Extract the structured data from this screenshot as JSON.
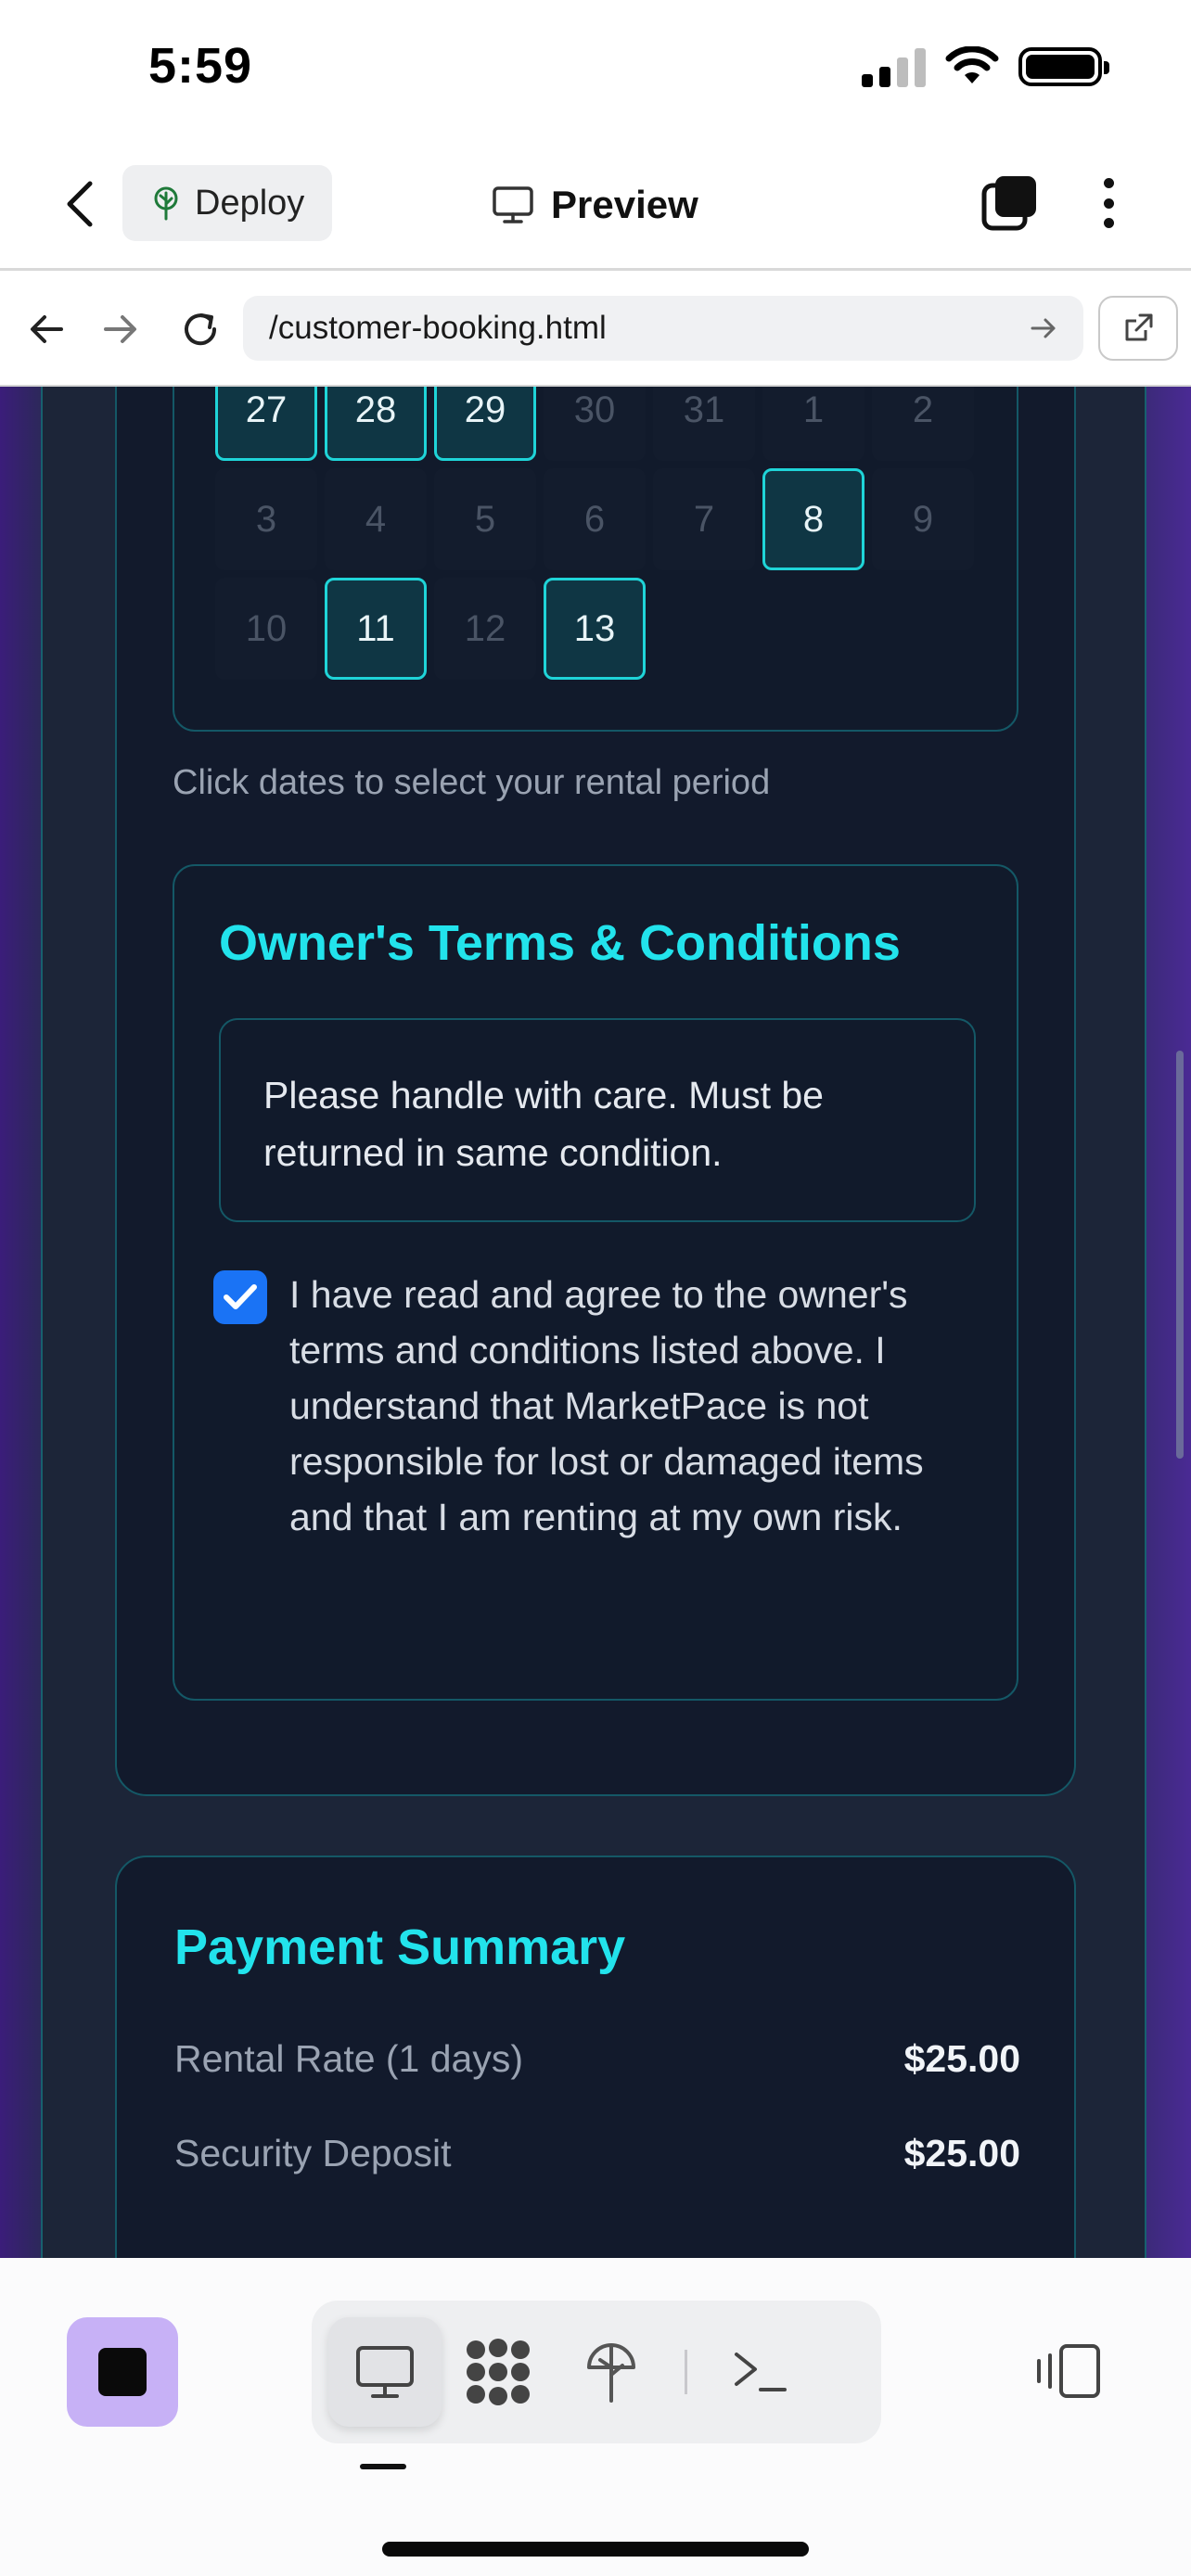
{
  "status_bar": {
    "time": "5:59"
  },
  "header": {
    "deploy_label": "Deploy",
    "preview_label": "Preview"
  },
  "url_bar": {
    "url": "/customer-booking.html"
  },
  "calendar": {
    "cells": [
      {
        "day": "27",
        "selected": true
      },
      {
        "day": "28",
        "selected": true
      },
      {
        "day": "29",
        "selected": true
      },
      {
        "day": "30",
        "selected": false
      },
      {
        "day": "31",
        "selected": false
      },
      {
        "day": "1",
        "selected": false
      },
      {
        "day": "2",
        "selected": false
      },
      {
        "day": "3",
        "selected": false
      },
      {
        "day": "4",
        "selected": false
      },
      {
        "day": "5",
        "selected": false
      },
      {
        "day": "6",
        "selected": false
      },
      {
        "day": "7",
        "selected": false
      },
      {
        "day": "8",
        "selected": true
      },
      {
        "day": "9",
        "selected": false
      },
      {
        "day": "10",
        "selected": false
      },
      {
        "day": "11",
        "selected": true
      },
      {
        "day": "12",
        "selected": false
      },
      {
        "day": "13",
        "selected": true
      }
    ],
    "hint": "Click dates to select your rental period"
  },
  "terms": {
    "title": "Owner's Terms & Conditions",
    "text": "Please handle with care. Must be returned in same condition.",
    "agree_checked": true,
    "agree_text": "I have read and agree to the owner's terms and conditions listed above. I understand that MarketPace is not responsible for lost or damaged items and that I am renting at my own risk."
  },
  "payment": {
    "title": "Payment Summary",
    "rows": [
      {
        "label": "Rental Rate (1 days)",
        "value": "$25.00"
      },
      {
        "label": "Security Deposit",
        "value": "$25.00"
      }
    ]
  },
  "colors": {
    "accent_cyan": "#22e3ec",
    "selected_border": "#1fd4d8",
    "checkbox_blue": "#1a73f5",
    "stop_button": "#c7b1f6"
  },
  "icons": {
    "back": "chevron-left-icon",
    "deploy": "tree-icon",
    "preview": "monitor-icon",
    "tabs": "tabs-icon",
    "more": "more-vertical-icon",
    "nav_back": "arrow-left-icon",
    "nav_forward": "arrow-right-icon",
    "reload": "reload-icon",
    "go": "arrow-right-icon",
    "external": "external-link-icon",
    "stop": "stop-icon",
    "desktop": "monitor-icon",
    "apps": "grid-blob-icon",
    "deploy_tab": "tree-icon",
    "terminal": "terminal-icon",
    "split": "split-view-icon"
  }
}
